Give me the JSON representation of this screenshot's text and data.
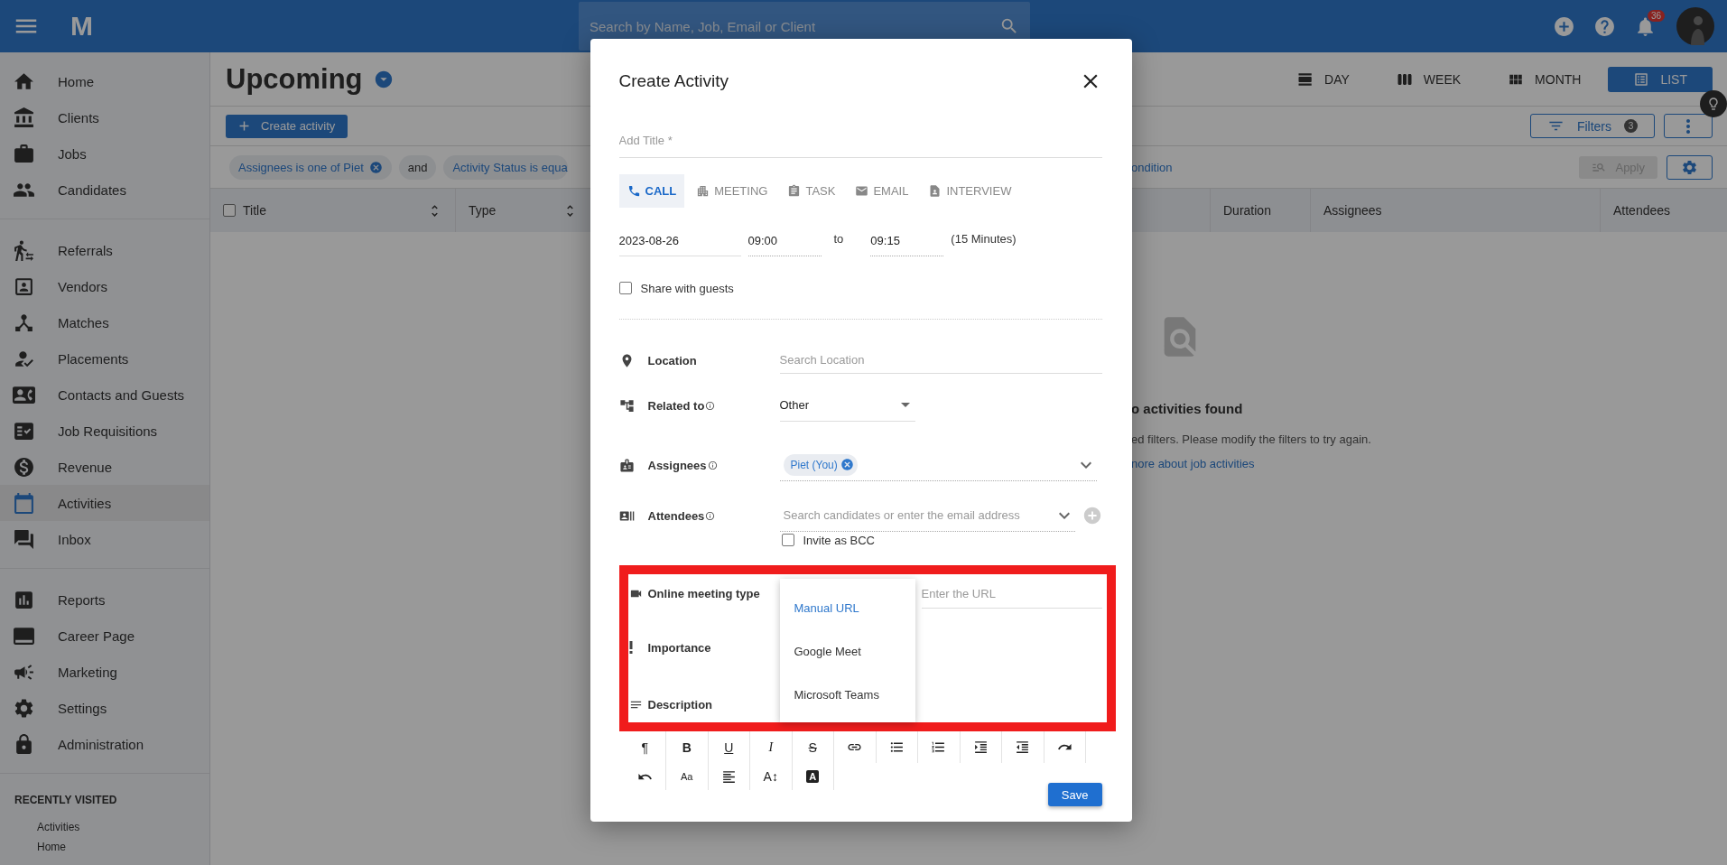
{
  "top_bar": {
    "logo": "M",
    "search": {
      "placeholder": "Search by Name, Job, Email or Client"
    },
    "notifications_badge": "36"
  },
  "sidebar": {
    "groups": [
      {
        "items": [
          {
            "label": "Home",
            "selected": false
          },
          {
            "label": "Clients",
            "selected": false
          },
          {
            "label": "Jobs",
            "selected": false
          },
          {
            "label": "Candidates",
            "selected": false
          }
        ]
      },
      {
        "items": [
          {
            "label": "Referrals",
            "selected": false
          },
          {
            "label": "Vendors",
            "selected": false
          },
          {
            "label": "Matches",
            "selected": false
          },
          {
            "label": "Placements",
            "selected": false
          },
          {
            "label": "Contacts and Guests",
            "selected": false
          },
          {
            "label": "Job Requisitions",
            "selected": false
          },
          {
            "label": "Revenue",
            "selected": false
          },
          {
            "label": "Activities",
            "selected": true
          },
          {
            "label": "Inbox",
            "selected": false
          }
        ]
      },
      {
        "items": [
          {
            "label": "Reports",
            "selected": false
          },
          {
            "label": "Career Page",
            "selected": false
          },
          {
            "label": "Marketing",
            "selected": false
          },
          {
            "label": "Settings",
            "selected": false
          },
          {
            "label": "Administration",
            "selected": false
          }
        ]
      }
    ],
    "recently_visited": {
      "title": "RECENTLY VISITED",
      "items": [
        "Activities",
        "Home"
      ]
    }
  },
  "page": {
    "title": "Upcoming",
    "create_button": "Create activity",
    "views": [
      {
        "label": "DAY",
        "selected": false
      },
      {
        "label": "WEEK",
        "selected": false
      },
      {
        "label": "MONTH",
        "selected": false
      },
      {
        "label": "LIST",
        "selected": true
      }
    ],
    "filters_button": {
      "label": "Filters",
      "count": "3"
    },
    "filter_chips": [
      {
        "kind": "condition",
        "label": "Assignees is one of Piet",
        "removable": true
      },
      {
        "kind": "operator",
        "label": "and"
      },
      {
        "kind": "condition",
        "label": "Activity Status is equa",
        "removable": false
      }
    ],
    "add_condition_link": "ondition",
    "apply_button": {
      "label": "Apply",
      "disabled": true
    },
    "table": {
      "select_all": {
        "checked": false
      },
      "columns_left": [
        {
          "label": "Title",
          "sortable": true
        },
        {
          "label": "Type",
          "sortable": true
        }
      ],
      "columns_right": [
        {
          "label": "Duration"
        },
        {
          "label": "Assignees"
        },
        {
          "label": "Attendees"
        }
      ]
    },
    "empty_state": {
      "title": "o activities found",
      "message": "ed filters. Please modify the filters to try again.",
      "link": "nore about job activities"
    }
  },
  "dialog": {
    "title": "Create Activity",
    "title_field": {
      "placeholder": "Add Title *"
    },
    "types": [
      {
        "label": "CALL",
        "selected": true
      },
      {
        "label": "MEETING",
        "selected": false
      },
      {
        "label": "TASK",
        "selected": false
      },
      {
        "label": "EMAIL",
        "selected": false
      },
      {
        "label": "INTERVIEW",
        "selected": false
      }
    ],
    "date": "2023-08-26",
    "start_time": "09:00",
    "to": "to",
    "end_time": "09:15",
    "duration": "(15 Minutes)",
    "share_with_guests": {
      "label": "Share with guests",
      "checked": false
    },
    "location": {
      "label": "Location",
      "info": false,
      "placeholder": "Search Location"
    },
    "related_to": {
      "label": "Related to",
      "info": true,
      "value": "Other"
    },
    "assignees": {
      "label": "Assignees",
      "info": true,
      "chips": [
        "Piet (You)"
      ]
    },
    "attendees": {
      "label": "Attendees",
      "info": true,
      "placeholder": "Search candidates or enter the email address",
      "invite_as_bcc": {
        "label": "Invite as BCC",
        "checked": false
      }
    },
    "online_meeting_type": {
      "label": "Online meeting type",
      "options": [
        {
          "label": "Manual URL",
          "selected": true
        },
        {
          "label": "Google Meet",
          "selected": false
        },
        {
          "label": "Microsoft Teams",
          "selected": false
        }
      ],
      "url": {
        "placeholder": "Enter the URL"
      }
    },
    "importance": {
      "label": "Importance"
    },
    "description": {
      "label": "Description"
    },
    "editor_toolbar": [
      [
        {
          "kind": "plain",
          "label": "¶"
        },
        {
          "kind": "bold",
          "label": "B"
        },
        {
          "kind": "underline",
          "label": "U"
        },
        {
          "kind": "italic",
          "label": "I"
        },
        {
          "kind": "strike",
          "label": "S"
        },
        {
          "kind": "icon"
        },
        {
          "kind": "icon"
        },
        {
          "kind": "icon"
        },
        {
          "kind": "icon"
        },
        {
          "kind": "icon"
        },
        {
          "kind": "icon"
        }
      ],
      [
        {
          "kind": "icon"
        },
        {
          "kind": "small",
          "label": "Aa"
        },
        {
          "kind": "icon"
        },
        {
          "kind": "plain",
          "label": "A↕"
        },
        {
          "kind": "inverse",
          "label": "A"
        }
      ]
    ],
    "save_button": "Save",
    "annotation": {
      "kind": "highlight-box"
    }
  }
}
